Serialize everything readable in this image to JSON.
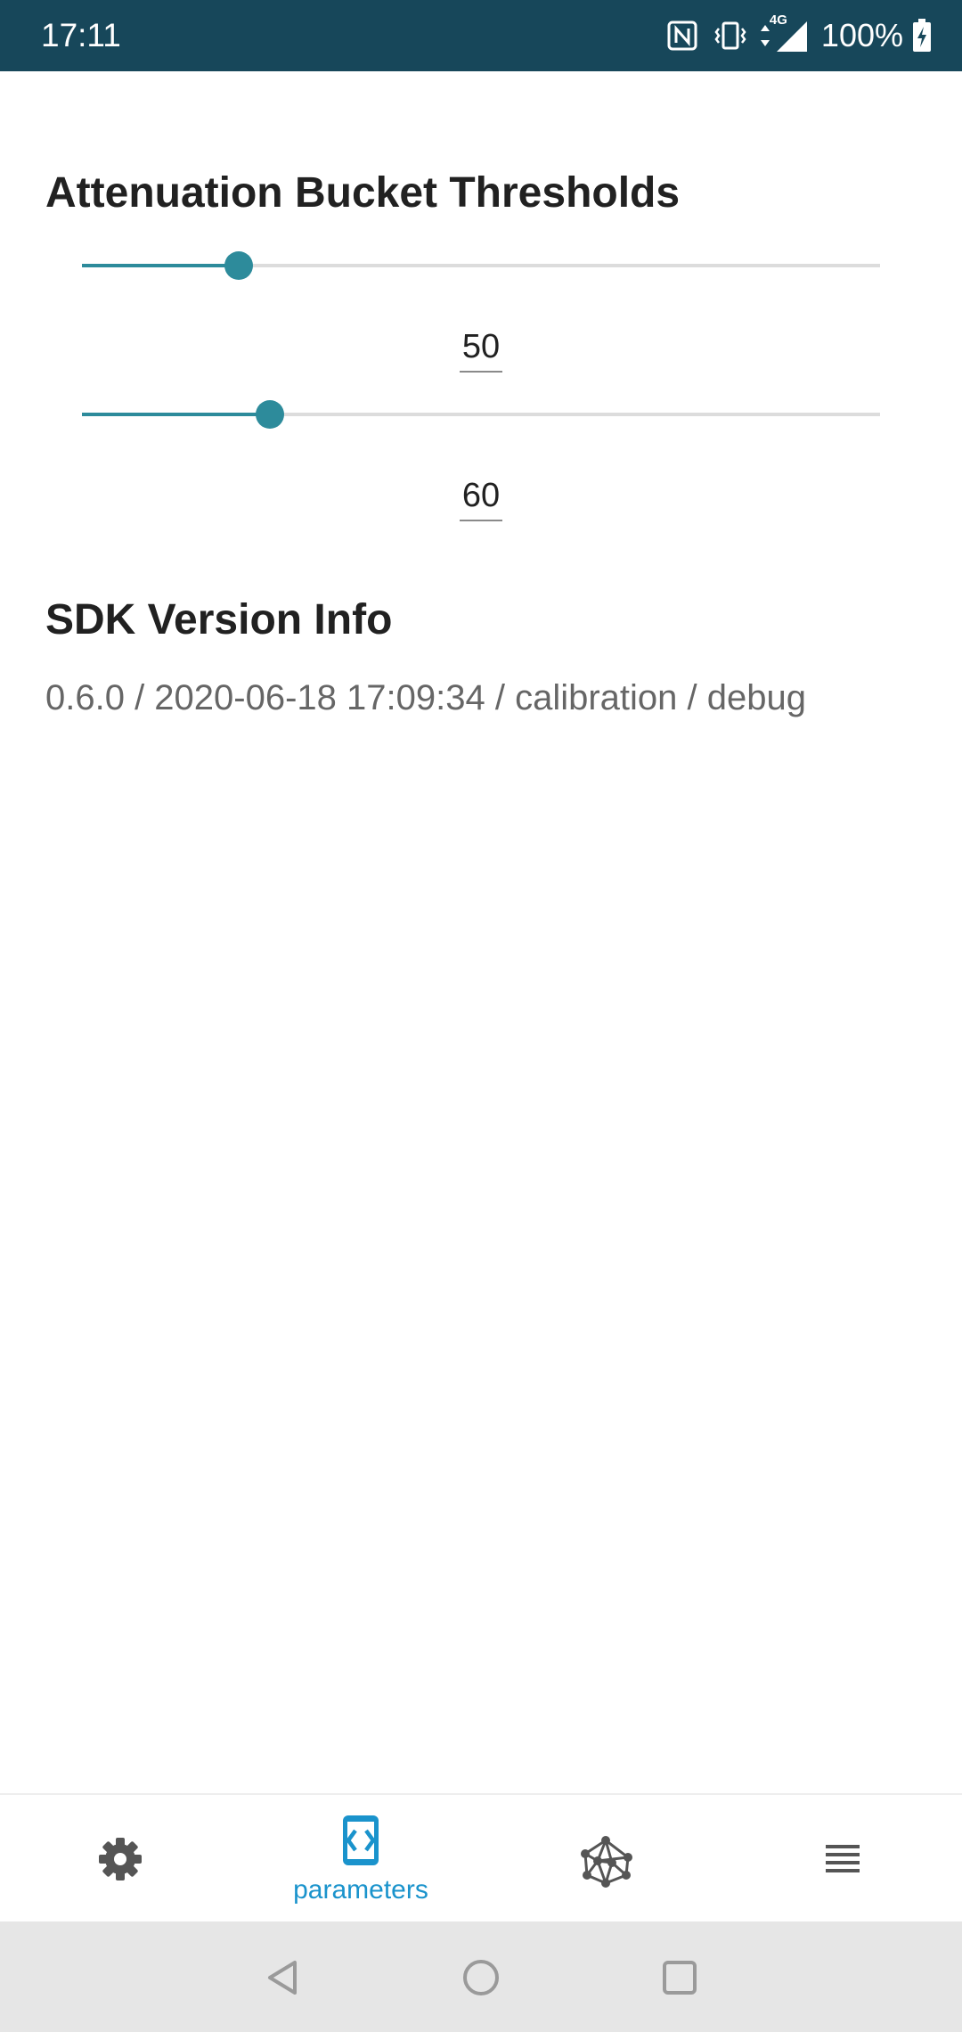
{
  "status_bar": {
    "time": "17:11",
    "network_type": "4G",
    "battery_percent": "100%",
    "icons": [
      "nfc-icon",
      "vibrate-icon",
      "data-transfer-icon",
      "signal-icon",
      "battery-charging-icon"
    ]
  },
  "attenuation": {
    "title": "Attenuation Bucket Thresholds",
    "sliders": [
      {
        "value": "50",
        "fraction": 0.196
      },
      {
        "value": "60",
        "fraction": 0.235
      }
    ]
  },
  "sdk": {
    "title": "SDK Version Info",
    "info": "0.6.0 / 2020-06-18 17:09:34 / calibration / debug"
  },
  "bottom_nav": {
    "items": [
      {
        "icon": "gear-icon",
        "label": "",
        "active": false
      },
      {
        "icon": "parameters-icon",
        "label": "parameters",
        "active": true
      },
      {
        "icon": "network-icon",
        "label": "",
        "active": false
      },
      {
        "icon": "list-icon",
        "label": "",
        "active": false
      }
    ]
  },
  "system_nav": {
    "icons": [
      "back-icon",
      "home-icon",
      "recents-icon"
    ]
  },
  "colors": {
    "status_bar": "#17475a",
    "accent": "#2d8b9b",
    "nav_active": "#1a93cc",
    "nav_inactive": "#555555"
  }
}
